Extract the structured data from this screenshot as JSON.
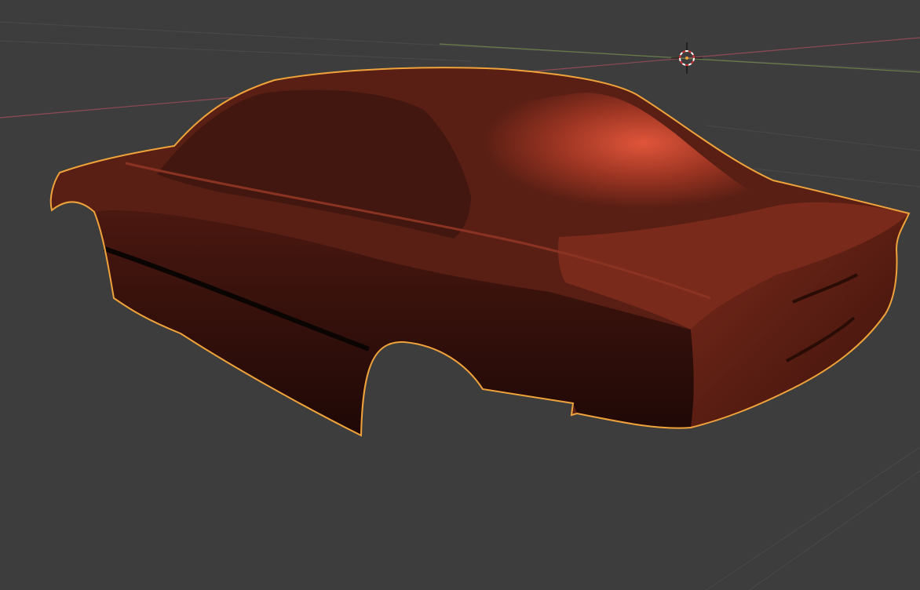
{
  "viewport": {
    "background": "#3d3d3d",
    "grid_line_color": "#4a4a4a",
    "x_axis_color": "#8f4b55",
    "y_axis_color": "#6b7d4a"
  },
  "object": {
    "name": "",
    "selected": true,
    "selection_outline_color": "#f0a33a",
    "base_color": "#5a1f14",
    "highlight_color": "#e0553a",
    "shadow_color": "#1e0806"
  },
  "cursor_3d": {
    "icon": "3d-cursor-icon",
    "ring_color_a": "#ffffff",
    "ring_color_b": "#d03030"
  }
}
